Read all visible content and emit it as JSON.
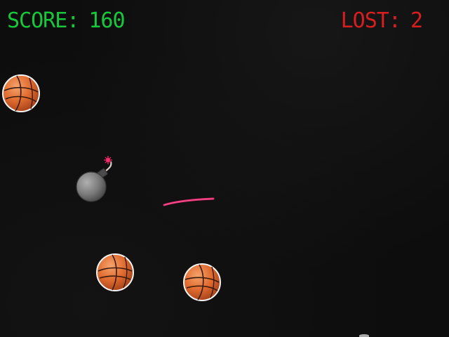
{
  "hud": {
    "score_label": "SCORE:",
    "score_value": "160",
    "lost_label": "LOST:",
    "lost_value": "2"
  },
  "colors": {
    "score": "#16c83a",
    "lost": "#d81e1e",
    "ball": "#e06b30",
    "bomb": "#7a7a7a",
    "trail": "#ff2d7a",
    "background": "#0d0d0d"
  },
  "objects": [
    {
      "type": "basketball",
      "icon": "basketball-icon"
    },
    {
      "type": "bomb",
      "icon": "bomb-icon"
    },
    {
      "type": "basketball",
      "icon": "basketball-icon"
    },
    {
      "type": "basketball",
      "icon": "basketball-icon"
    },
    {
      "type": "slice-trail",
      "icon": "slice-trail-icon"
    }
  ]
}
